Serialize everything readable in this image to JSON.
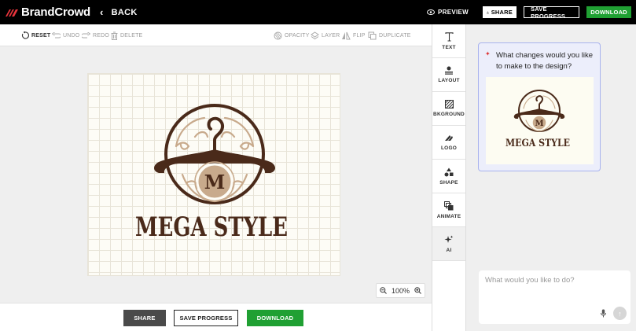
{
  "header": {
    "brand": "BrandCrowd",
    "back_label": "BACK",
    "preview_label": "PREVIEW",
    "share_label": "SHARE",
    "save_label": "SAVE PROGRESS",
    "download_label": "DOWNLOAD"
  },
  "toolbar": {
    "reset": "RESET",
    "undo": "UNDO",
    "redo": "REDO",
    "delete": "DELETE",
    "opacity": "OPACITY",
    "layer": "LAYER",
    "flip": "FLIP",
    "duplicate": "DUPLICATE"
  },
  "canvas": {
    "logo_initial": "M",
    "logo_text": "MEGA STYLE",
    "zoom_level": "100%"
  },
  "bottom": {
    "share_label": "SHARE",
    "save_label": "SAVE PROGRESS",
    "download_label": "DOWNLOAD"
  },
  "side": {
    "items": [
      {
        "label": "TEXT",
        "icon": "text-icon"
      },
      {
        "label": "LAYOUT",
        "icon": "layout-icon"
      },
      {
        "label": "BKGROUND",
        "icon": "background-icon"
      },
      {
        "label": "LOGO",
        "icon": "logo-icon"
      },
      {
        "label": "SHAPE",
        "icon": "shape-icon"
      },
      {
        "label": "ANIMATE",
        "icon": "animate-icon"
      },
      {
        "label": "AI",
        "icon": "ai-sparkle-icon"
      }
    ]
  },
  "ai": {
    "prompt": "What changes would you like to make to the design?",
    "thumb_initial": "M",
    "thumb_text": "MEGA STYLE",
    "input_placeholder": "What would you like to do?"
  },
  "colors": {
    "accent_green": "#20a033",
    "logo_brown": "#4a2a1a",
    "logo_beige": "#c8aa8c",
    "ai_border": "#a9b3ee"
  }
}
